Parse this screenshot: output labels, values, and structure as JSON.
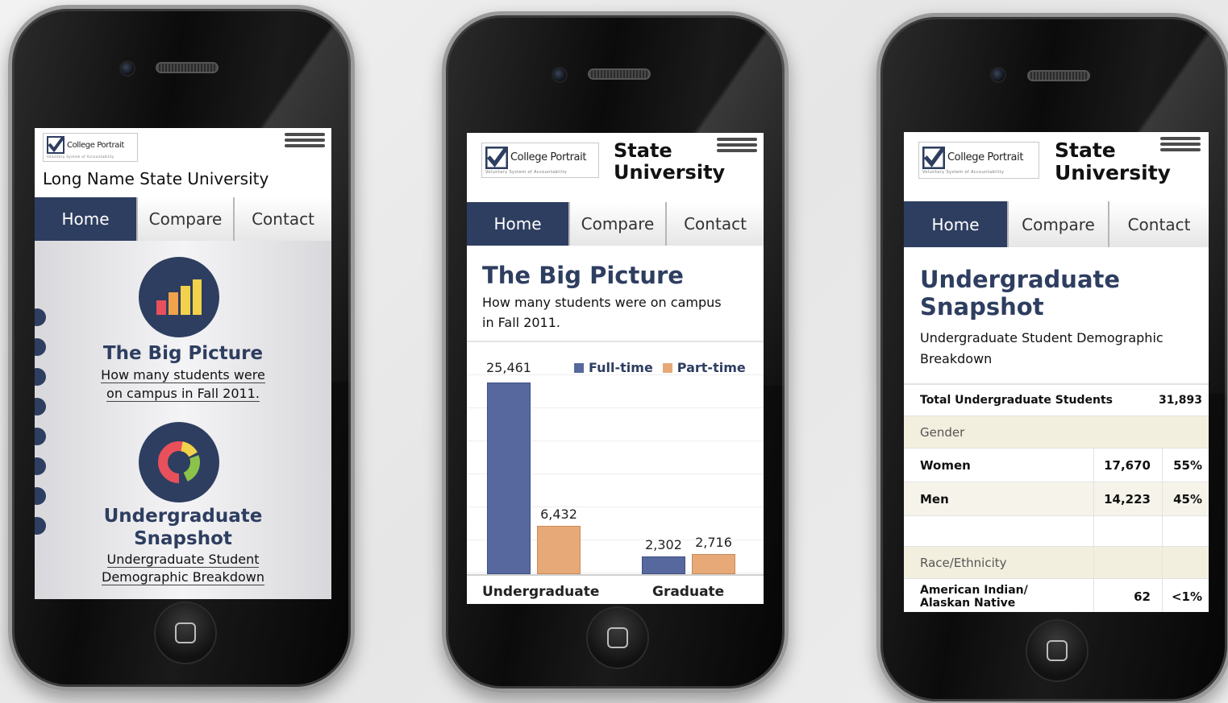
{
  "brand": {
    "logo_text": "College Portrait",
    "logo_subtext": "Voluntary System of Accountability",
    "nav_color": "#2e3e60"
  },
  "nav": [
    "Home",
    "Compare",
    "Contact"
  ],
  "phone1": {
    "university": "Long Name State University",
    "big_picture": {
      "title": "The Big Picture",
      "link_line1": "How many students were",
      "link_line2": "on campus in Fall 2011."
    },
    "snapshot": {
      "title_line1": "Undergraduate",
      "title_line2": "Snapshot",
      "link_line1": "Undergraduate Student",
      "link_line2": "Demographic Breakdown"
    }
  },
  "phone2": {
    "university_line1": "State",
    "university_line2": "University",
    "title": "The Big Picture",
    "subtitle_line1": "How many students were on campus",
    "subtitle_line2": "in Fall 2011."
  },
  "chart_data": {
    "type": "bar",
    "categories": [
      "Undergraduate",
      "Graduate"
    ],
    "series": [
      {
        "name": "Full-time",
        "values": [
          25461,
          2302
        ],
        "labels": [
          "25,461",
          "2,302"
        ],
        "color": "#56689e"
      },
      {
        "name": "Part-time",
        "values": [
          6432,
          2716
        ],
        "labels": [
          "6,432",
          "2,716"
        ],
        "color": "#e7a977"
      }
    ],
    "ylim": [
      0,
      25461
    ],
    "grid": true,
    "legend": "top-right"
  },
  "phone3": {
    "university_line1": "State",
    "university_line2": "University",
    "title_line1": "Undergraduate",
    "title_line2": "Snapshot",
    "subtitle_line1": "Undergraduate Student Demographic",
    "subtitle_line2": "Breakdown",
    "total_label": "Total Undergraduate Students",
    "total_value": "31,893",
    "gender_label": "Gender",
    "women_label": "Women",
    "women_count": "17,670",
    "women_pct": "55%",
    "men_label": "Men",
    "men_count": "14,223",
    "men_pct": "45%",
    "race_label": "Race/Ethnicity",
    "ai_label_line1": "American Indian/",
    "ai_label_line2": "Alaskan Native",
    "ai_count": "62",
    "ai_pct": "<1%"
  }
}
